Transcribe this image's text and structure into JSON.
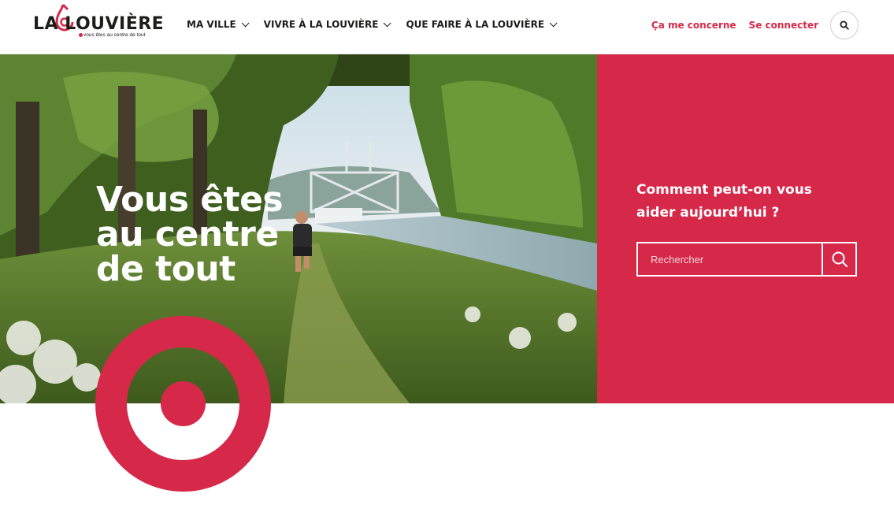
{
  "header": {
    "logo": {
      "name": "LA LOUVIÈRE",
      "tagline": "vous êtes au centre de tout"
    },
    "nav": [
      {
        "label": "MA VILLE"
      },
      {
        "label": "VIVRE À LA LOUVIÈRE"
      },
      {
        "label": "QUE FAIRE À LA LOUVIÈRE"
      }
    ],
    "links": {
      "concern": "Ça me concerne",
      "login": "Se connecter"
    },
    "search_icon": "search-icon"
  },
  "hero": {
    "title_line1": "Vous êtes",
    "title_line2": "au centre",
    "title_line3": "de tout",
    "panel": {
      "question_line1": "Comment peut-on vous",
      "question_line2": "aider aujourd’hui ?",
      "search_placeholder": "Rechercher",
      "search_icon": "search-icon"
    }
  },
  "colors": {
    "brand": "#d6294a",
    "text": "#1d1d1b",
    "white": "#ffffff"
  }
}
